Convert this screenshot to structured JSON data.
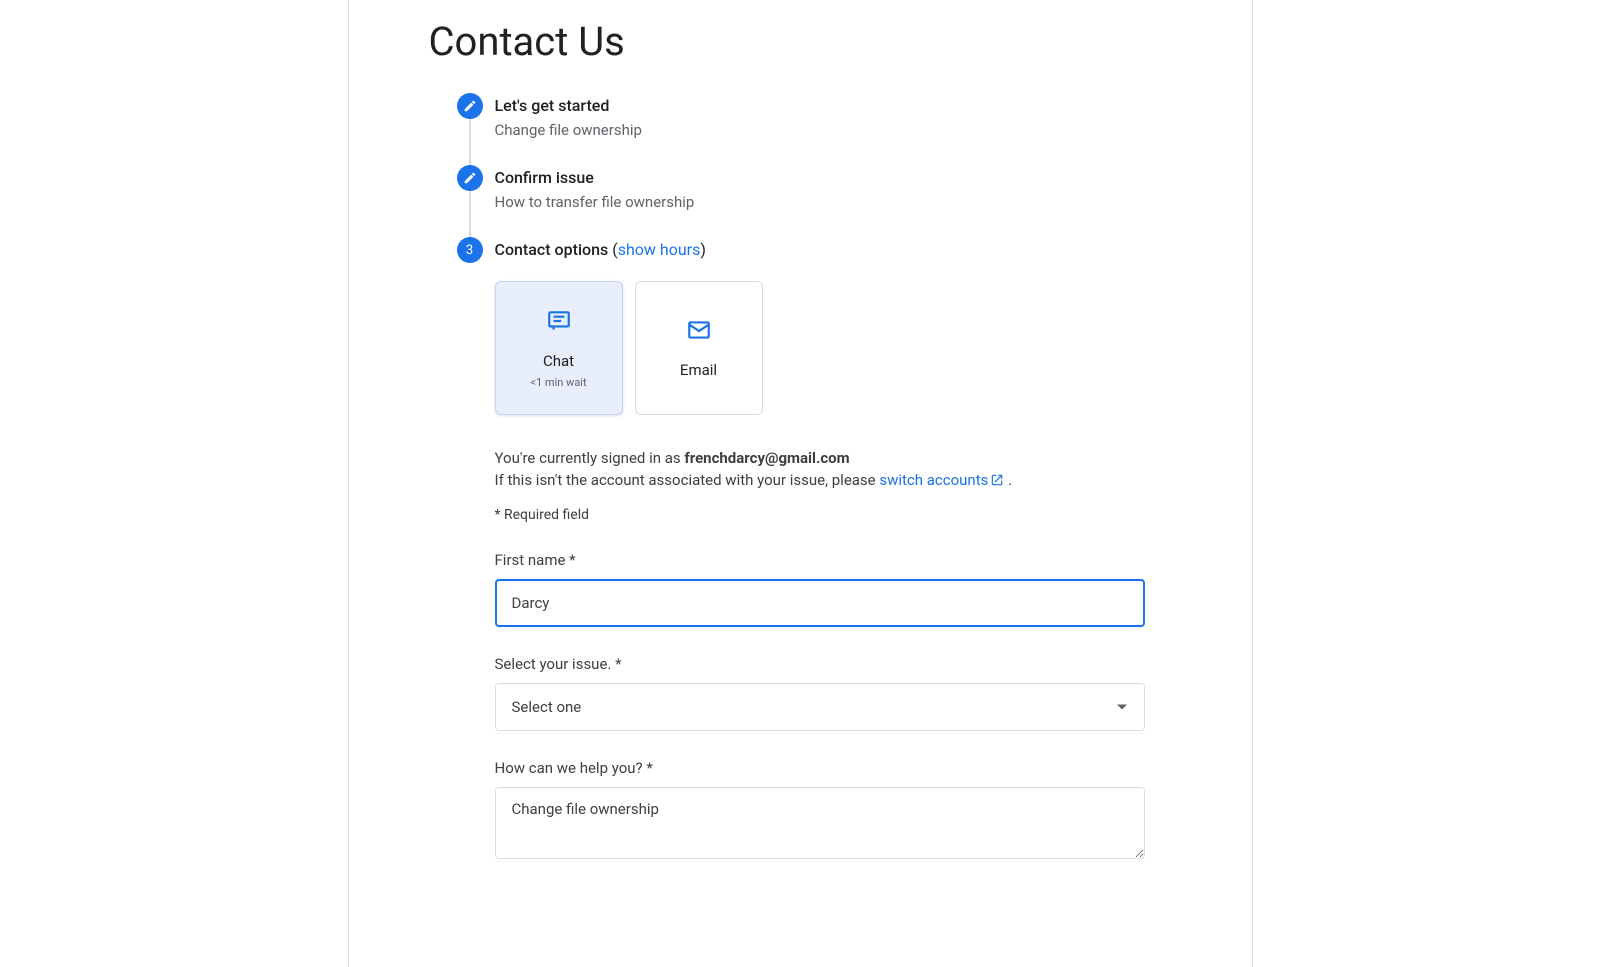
{
  "page": {
    "title": "Contact Us"
  },
  "steps": [
    {
      "title": "Let's get started",
      "sub": "Change file ownership",
      "icon": "edit",
      "badge": ""
    },
    {
      "title": "Confirm issue",
      "sub": "How to transfer file ownership",
      "icon": "edit",
      "badge": ""
    },
    {
      "title_prefix": "Contact options",
      "show_hours_link": "show hours",
      "badge": "3"
    }
  ],
  "cards": {
    "chat": {
      "label": "Chat",
      "meta": "<1 min wait"
    },
    "email": {
      "label": "Email"
    }
  },
  "account": {
    "signed_in_prefix": "You're currently signed in as ",
    "email": "frenchdarcy@gmail.com",
    "switch_prefix": "If this isn't the account associated with your issue, please ",
    "switch_link": "switch accounts",
    "switch_suffix": " ."
  },
  "required_note": "* Required field",
  "form": {
    "first_name": {
      "label": "First name *",
      "value": "Darcy"
    },
    "issue": {
      "label": "Select your issue. *",
      "placeholder": "Select one"
    },
    "help": {
      "label": "How can we help you? *",
      "value": "Change file ownership"
    }
  }
}
